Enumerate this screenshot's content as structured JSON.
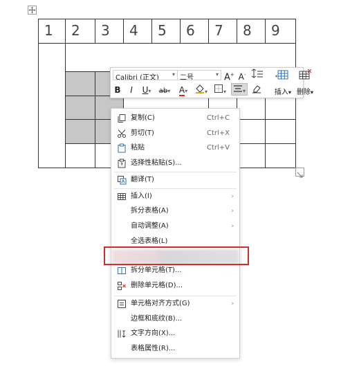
{
  "table": {
    "header_cells": [
      "1",
      "2",
      "3",
      "4",
      "5",
      "6",
      "7",
      "8",
      "9"
    ]
  },
  "toolbar": {
    "font_name": "Calibri (正文)",
    "font_size": "二号",
    "grow_font": "A",
    "shrink_font": "A",
    "bold": "B",
    "italic": "I",
    "underline": "U",
    "strike": "ab",
    "font_color": "A",
    "insert_label": "插入",
    "delete_label": "删除"
  },
  "context_menu": {
    "items": [
      {
        "label": "复制(C)",
        "shortcut": "Ctrl+C"
      },
      {
        "label": "剪切(T)",
        "shortcut": "Ctrl+X"
      },
      {
        "label": "粘贴",
        "shortcut": "Ctrl+V"
      },
      {
        "label": "选择性粘贴(S)..."
      },
      {
        "label": "翻译(T)"
      },
      {
        "label": "插入(I)"
      },
      {
        "label": "拆分表格(A)"
      },
      {
        "label": "自动调整(A)"
      },
      {
        "label": "全选表格(L)"
      },
      {
        "label": "拆分单元格(T)..."
      },
      {
        "label": "删除单元格(D)..."
      },
      {
        "label": "单元格对齐方式(G)"
      },
      {
        "label": "边框和底纹(B)..."
      },
      {
        "label": "文字方向(X)..."
      },
      {
        "label": "表格属性(R)..."
      }
    ]
  },
  "colors": {
    "highlight_border": "#d62b2b",
    "gray_cell": "#c7c7c7"
  }
}
